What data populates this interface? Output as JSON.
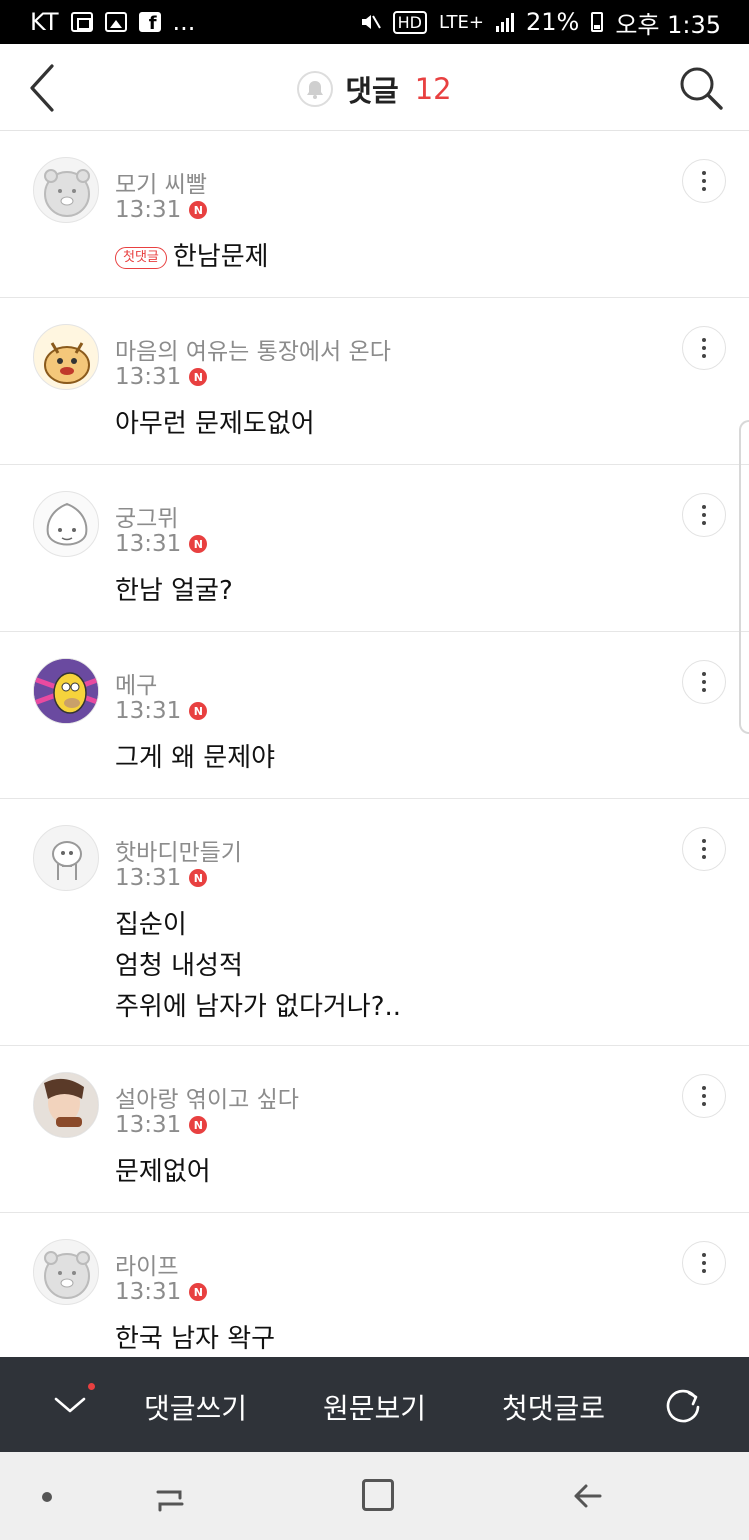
{
  "status_bar": {
    "carrier": "KT",
    "overflow": "...",
    "network": "LTE+",
    "hd": "HD",
    "battery": "21%",
    "time": "오후 1:35"
  },
  "header": {
    "title": "댓글",
    "count": "12",
    "icons": [
      "back-arrow-icon",
      "bell-icon",
      "search-icon"
    ]
  },
  "comments": [
    {
      "author": "모기 씨빨",
      "time": "13:31",
      "badge": "N",
      "first_label": "첫댓글",
      "lines": [
        "한남문제"
      ]
    },
    {
      "author": "마음의 여유는 통장에서 온다",
      "time": "13:31",
      "badge": "N",
      "lines": [
        "아무런 문제도없어"
      ]
    },
    {
      "author": "궁그뮈",
      "time": "13:31",
      "badge": "N",
      "lines": [
        "한남 얼굴?"
      ]
    },
    {
      "author": "메구",
      "time": "13:31",
      "badge": "N",
      "lines": [
        "그게 왜 문제야"
      ]
    },
    {
      "author": "핫바디만들기",
      "time": "13:31",
      "badge": "N",
      "lines": [
        "집순이",
        "엄청 내성적",
        "주위에 남자가 없다거나?.."
      ]
    },
    {
      "author": "설아랑 엮이고 싶다",
      "time": "13:31",
      "badge": "N",
      "lines": [
        "문제없어"
      ]
    },
    {
      "author": "라이프",
      "time": "13:31",
      "badge": "N",
      "lines": [
        "한국 남자 왁구"
      ]
    }
  ],
  "action_bar": {
    "write": "댓글쓰기",
    "original": "원문보기",
    "first_comment": "첫댓글로",
    "accent": "#e84040",
    "background": "#2f3339"
  }
}
